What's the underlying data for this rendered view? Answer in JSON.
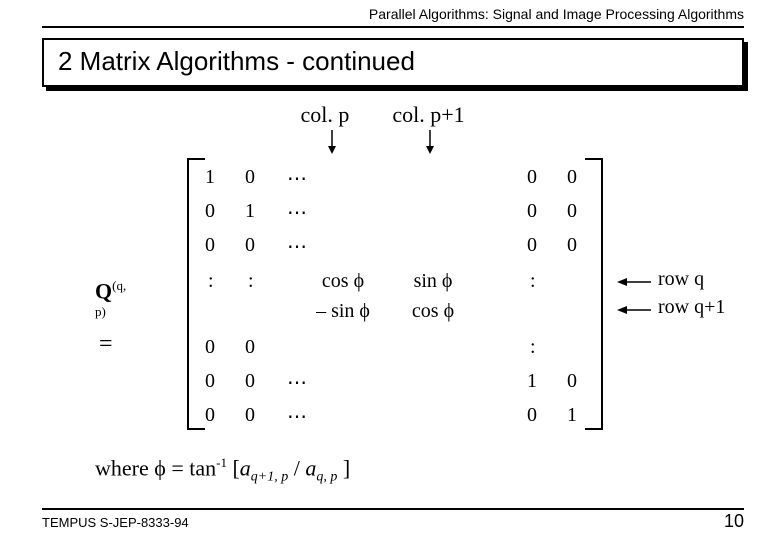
{
  "header": "Parallel Algorithms:  Signal and Image Processing Algorithms",
  "title": "2  Matrix Algorithms - continued",
  "cols": {
    "p": "col. p",
    "p1": "col. p+1"
  },
  "matrix": {
    "label_Q": "Q",
    "label_sup": "(q, p)",
    "label_eq": "=",
    "r1": [
      "1",
      "0",
      "⋯",
      "",
      "",
      "",
      "0",
      "0"
    ],
    "r2": [
      "0",
      "1",
      "⋯",
      "",
      "",
      "",
      "0",
      "0"
    ],
    "r3": [
      "0",
      "0",
      "⋯",
      "",
      "",
      "",
      "0",
      "0"
    ],
    "r4": [
      ":",
      ":",
      "",
      "cos ϕ",
      "sin ϕ",
      "",
      ":",
      ""
    ],
    "r5": [
      "",
      "",
      "",
      "– sin ϕ",
      "cos ϕ",
      "",
      "",
      ""
    ],
    "r6": [
      "0",
      "0",
      "",
      "",
      "",
      "",
      ":",
      ""
    ],
    "r7": [
      "0",
      "0",
      "⋯",
      "",
      "",
      "",
      "1",
      "0"
    ],
    "r8": [
      "0",
      "0",
      "⋯",
      "",
      "",
      "",
      "0",
      "1"
    ]
  },
  "rows": {
    "q": "row q",
    "q1": "row q+1"
  },
  "where": {
    "prefix": "where ϕ = tan",
    "sup": "-1",
    "open": " [",
    "a": "a",
    "sub1": "q+1, p",
    "slash": " / ",
    "sub2": "q, p",
    "close": " ]"
  },
  "footer": {
    "left": "TEMPUS S-JEP-8333-94",
    "right": "10"
  }
}
